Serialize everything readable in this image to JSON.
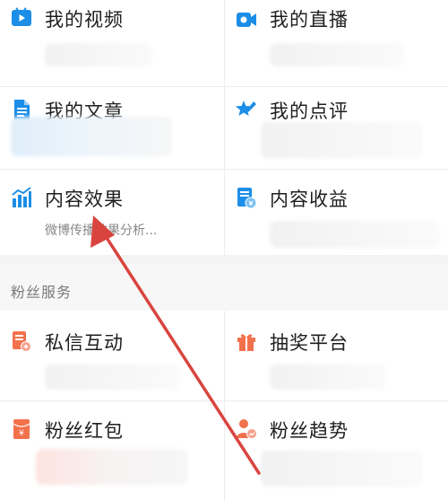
{
  "grid_top": [
    [
      {
        "name": "my-videos",
        "title": "我的视频",
        "icon": "video-play-icon"
      },
      {
        "name": "my-live",
        "title": "我的直播",
        "icon": "camera-icon"
      }
    ],
    [
      {
        "name": "my-articles",
        "title": "我的文章",
        "icon": "document-icon"
      },
      {
        "name": "my-reviews",
        "title": "我的点评",
        "icon": "star-review-icon"
      }
    ],
    [
      {
        "name": "content-effect",
        "title": "内容效果",
        "subtitle": "微博传播效果分析...",
        "icon": "bar-chart-icon"
      },
      {
        "name": "content-earnings",
        "title": "内容收益",
        "icon": "earnings-icon"
      }
    ]
  ],
  "section": {
    "label": "粉丝服务"
  },
  "grid_bottom": [
    [
      {
        "name": "private-message",
        "title": "私信互动",
        "icon": "message-doc-icon"
      },
      {
        "name": "lottery-platform",
        "title": "抽奖平台",
        "icon": "gift-icon"
      }
    ],
    [
      {
        "name": "fan-red-packet",
        "title": "粉丝红包",
        "icon": "red-packet-icon"
      },
      {
        "name": "fan-trends",
        "title": "粉丝趋势",
        "icon": "fan-trend-icon"
      }
    ]
  ],
  "colors": {
    "icon_blue": "#1c8ee8",
    "icon_orange": "#f2714d",
    "annotation_red": "#d9443f"
  }
}
